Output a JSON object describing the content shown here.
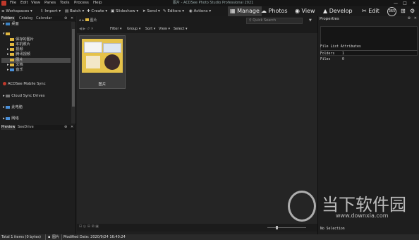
{
  "window": {
    "title": "图片 - ACDSee Photo Studio Professional 2021",
    "controls": [
      "—",
      "□",
      "✕"
    ]
  },
  "menu": [
    "File",
    "Edit",
    "View",
    "Panes",
    "Tools",
    "Process",
    "Help"
  ],
  "toolbar": {
    "workspaces": "Workspaces",
    "import": "Import",
    "batch": "Batch",
    "create": "Create",
    "slideshow": "Slideshow",
    "send": "Send",
    "editors": "Editors",
    "actions": "Actions"
  },
  "modes": {
    "manage": "Manage",
    "photos": "Photos",
    "view": "View",
    "develop": "Develop",
    "edit": "Edit",
    "badge": "365"
  },
  "left_tabs": [
    "Folders",
    "Catalog",
    "Calendar"
  ],
  "tree": [
    "桌面",
    "",
    "保存的图片",
    "本机照片",
    "视频",
    "腾讯视频",
    "图片",
    "文档",
    "音乐",
    "ACDSee Mobile Sync",
    "Cloud Sync Drives",
    "此电脑",
    "网络"
  ],
  "preview_tabs": [
    "Preview",
    "SeeDrive"
  ],
  "center": {
    "path": "图片",
    "search_placeholder": "Quick Search",
    "filters": [
      "Filter",
      "Group",
      "Sort",
      "View",
      "Select"
    ],
    "thumb_label": "图片"
  },
  "properties": {
    "title": "Properties",
    "file_list_heading": "File List Attributes",
    "folders_label": "Folders",
    "folders_value": "1",
    "files_label": "Files",
    "files_value": "0",
    "no_selection": "No Selection"
  },
  "status": {
    "total": "Total 1 items (0 bytes)",
    "folder": "图片",
    "modified": "Modified Date: 2020/9/24 16:40:24"
  },
  "watermark": {
    "cn": "当下软件园",
    "url": "www.downxia.com"
  },
  "colors": {
    "accent": "#e0b73f",
    "active_mode": "#3a3a3a",
    "selection": "#4a4a4a",
    "red": "#c0392b"
  }
}
